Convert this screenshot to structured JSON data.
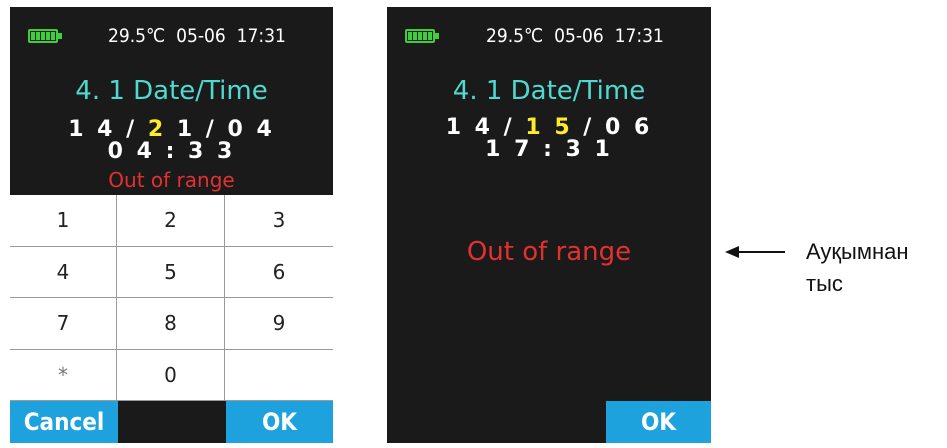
{
  "left_screen": {
    "status": {
      "temperature": "29.5℃",
      "date": "05-06",
      "time": "17:31"
    },
    "title": "4. 1  Date/Time",
    "date_pre": "1 4 / ",
    "date_hl": "2",
    "date_post": " 1 / 0 4",
    "time": "0 4 : 3 3",
    "error": "Out of range",
    "keypad": [
      "1",
      "2",
      "3",
      "4",
      "5",
      "6",
      "7",
      "8",
      "9",
      "*",
      "0",
      ""
    ],
    "cancel_label": "Cancel",
    "ok_label": "OK"
  },
  "right_screen": {
    "status": {
      "temperature": "29.5℃",
      "date": "05-06",
      "time": "17:31"
    },
    "title": "4. 1  Date/Time",
    "date_pre": "1 4 / ",
    "date_hl": "1 5",
    "date_post": " / 0 6",
    "time": "1 7 : 3 1",
    "error": "Out of range",
    "ok_label": "OK"
  },
  "annotation": {
    "line1": "Ауқымнан",
    "line2": "тыс"
  },
  "colors": {
    "background": "#1a1a1a",
    "title": "#4fd9cf",
    "highlight": "#ffeb2a",
    "error": "#e53030",
    "button": "#1ea2de",
    "battery": "#3fcf3a"
  }
}
